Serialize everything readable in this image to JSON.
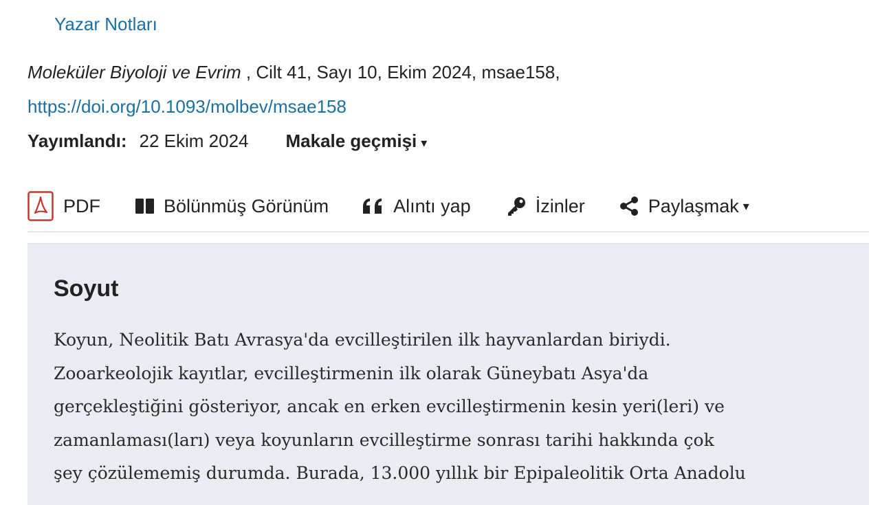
{
  "header": {
    "author_notes": "Yazar Notları"
  },
  "citation": {
    "journal": "Moleküler Biyoloji ve Evrim",
    "details": " , Cilt 41, Sayı 10, Ekim 2024, msae158,",
    "doi": "https://doi.org/10.1093/molbev/msae158"
  },
  "published": {
    "label": "Yayımlandı:",
    "date": "22 Ekim 2024",
    "history_label": "Makale geçmişi",
    "history_caret": "▾"
  },
  "toolbar": {
    "pdf": "PDF",
    "split_view": "Bölünmüş Görünüm",
    "cite": "Alıntı yap",
    "permissions": "İzinler",
    "share": "Paylaşmak",
    "share_caret": "▾"
  },
  "icons": {
    "pdf": "pdf-icon",
    "split": "split-view-icon",
    "cite": "quote-icon",
    "permissions": "key-icon",
    "share": "share-icon"
  },
  "colors": {
    "link": "#1a6fa3",
    "abstract_bg": "#e9edf2",
    "pdf_red": "#c0392b"
  },
  "abstract": {
    "title": "Soyut",
    "lines": [
      "Koyun, Neolitik Batı Avrasya'da evcilleştirilen ilk hayvanlardan biriydi.",
      "Zooarkeolojik kayıtlar, evcilleştirmenin ilk olarak Güneybatı Asya'da",
      "gerçekleştiğini gösteriyor, ancak en erken evcilleştirmenin kesin yeri(leri) ve",
      "zamanlaması(ları) veya koyunların evcilleştirme sonrası tarihi hakkında çok",
      "şey çözülememiş durumda. Burada, 13.000 yıllık bir Epipaleolitik Orta Anadolu"
    ]
  }
}
